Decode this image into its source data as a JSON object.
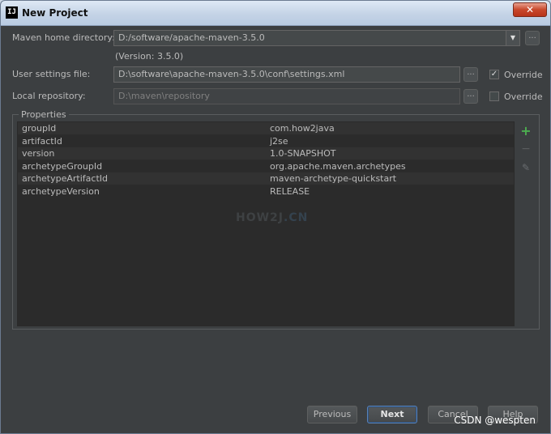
{
  "window": {
    "title": "New Project",
    "app_icon": "IJ",
    "close_glyph": "✕"
  },
  "form": {
    "maven_home": {
      "label": "Maven home directory:",
      "value": "D:/software/apache-maven-3.5.0",
      "version": "(Version: 3.5.0)"
    },
    "user_settings": {
      "label": "User settings file:",
      "value": "D:\\software\\apache-maven-3.5.0\\conf\\settings.xml",
      "override_label": "Override",
      "override_checked": true
    },
    "local_repo": {
      "label": "Local repository:",
      "value": "D:\\maven\\repository",
      "override_label": "Override",
      "override_checked": false
    },
    "browse_glyph": "..."
  },
  "properties": {
    "title": "Properties",
    "rows": [
      {
        "key": "groupId",
        "value": "com.how2java"
      },
      {
        "key": "artifactId",
        "value": "j2se"
      },
      {
        "key": "version",
        "value": "1.0-SNAPSHOT"
      },
      {
        "key": "archetypeGroupId",
        "value": "org.apache.maven.archetypes"
      },
      {
        "key": "archetypeArtifactId",
        "value": "maven-archetype-quickstart"
      },
      {
        "key": "archetypeVersion",
        "value": "RELEASE"
      }
    ],
    "toolbar": {
      "add": "+",
      "remove": "−",
      "edit": "✎"
    },
    "watermark": {
      "main": "HOW2J",
      "suffix": ".CN"
    }
  },
  "buttons": {
    "previous": "Previous",
    "next": "Next",
    "cancel": "Cancel",
    "help": "Help"
  },
  "colors": {
    "background": "#3c3f41",
    "table": "#2b2b2b",
    "row_alt": "#323232",
    "add": "#4caf50",
    "default_border": "#5a83b8"
  },
  "credit": "CSDN @wespten"
}
